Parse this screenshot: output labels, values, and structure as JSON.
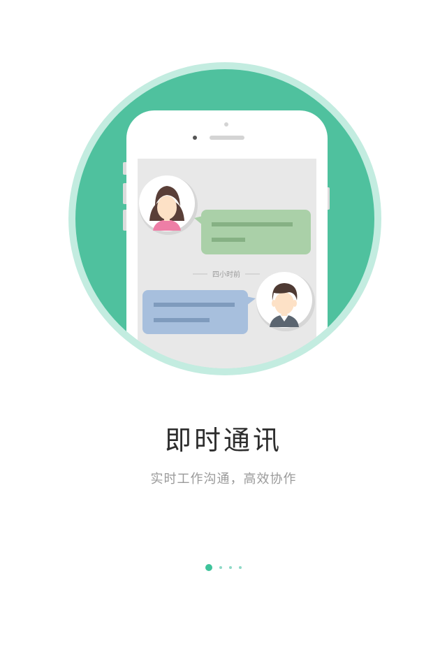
{
  "illustration": {
    "timestamp_label": "四小时前",
    "colors": {
      "circle_fill": "#4fc19e",
      "circle_ring": "#c3ece0",
      "phone_body": "#ffffff",
      "screen": "#e8e8e8",
      "bubble_green": "#aad0a8",
      "bubble_blue": "#a7bfdd"
    }
  },
  "onboarding": {
    "title": "即时通讯",
    "subtitle": "实时工作沟通，高效协作"
  },
  "pager": {
    "total_pages": 4,
    "current_page": 1,
    "colors": {
      "active": "#3fc39b",
      "inactive": "#8fdac7"
    }
  }
}
